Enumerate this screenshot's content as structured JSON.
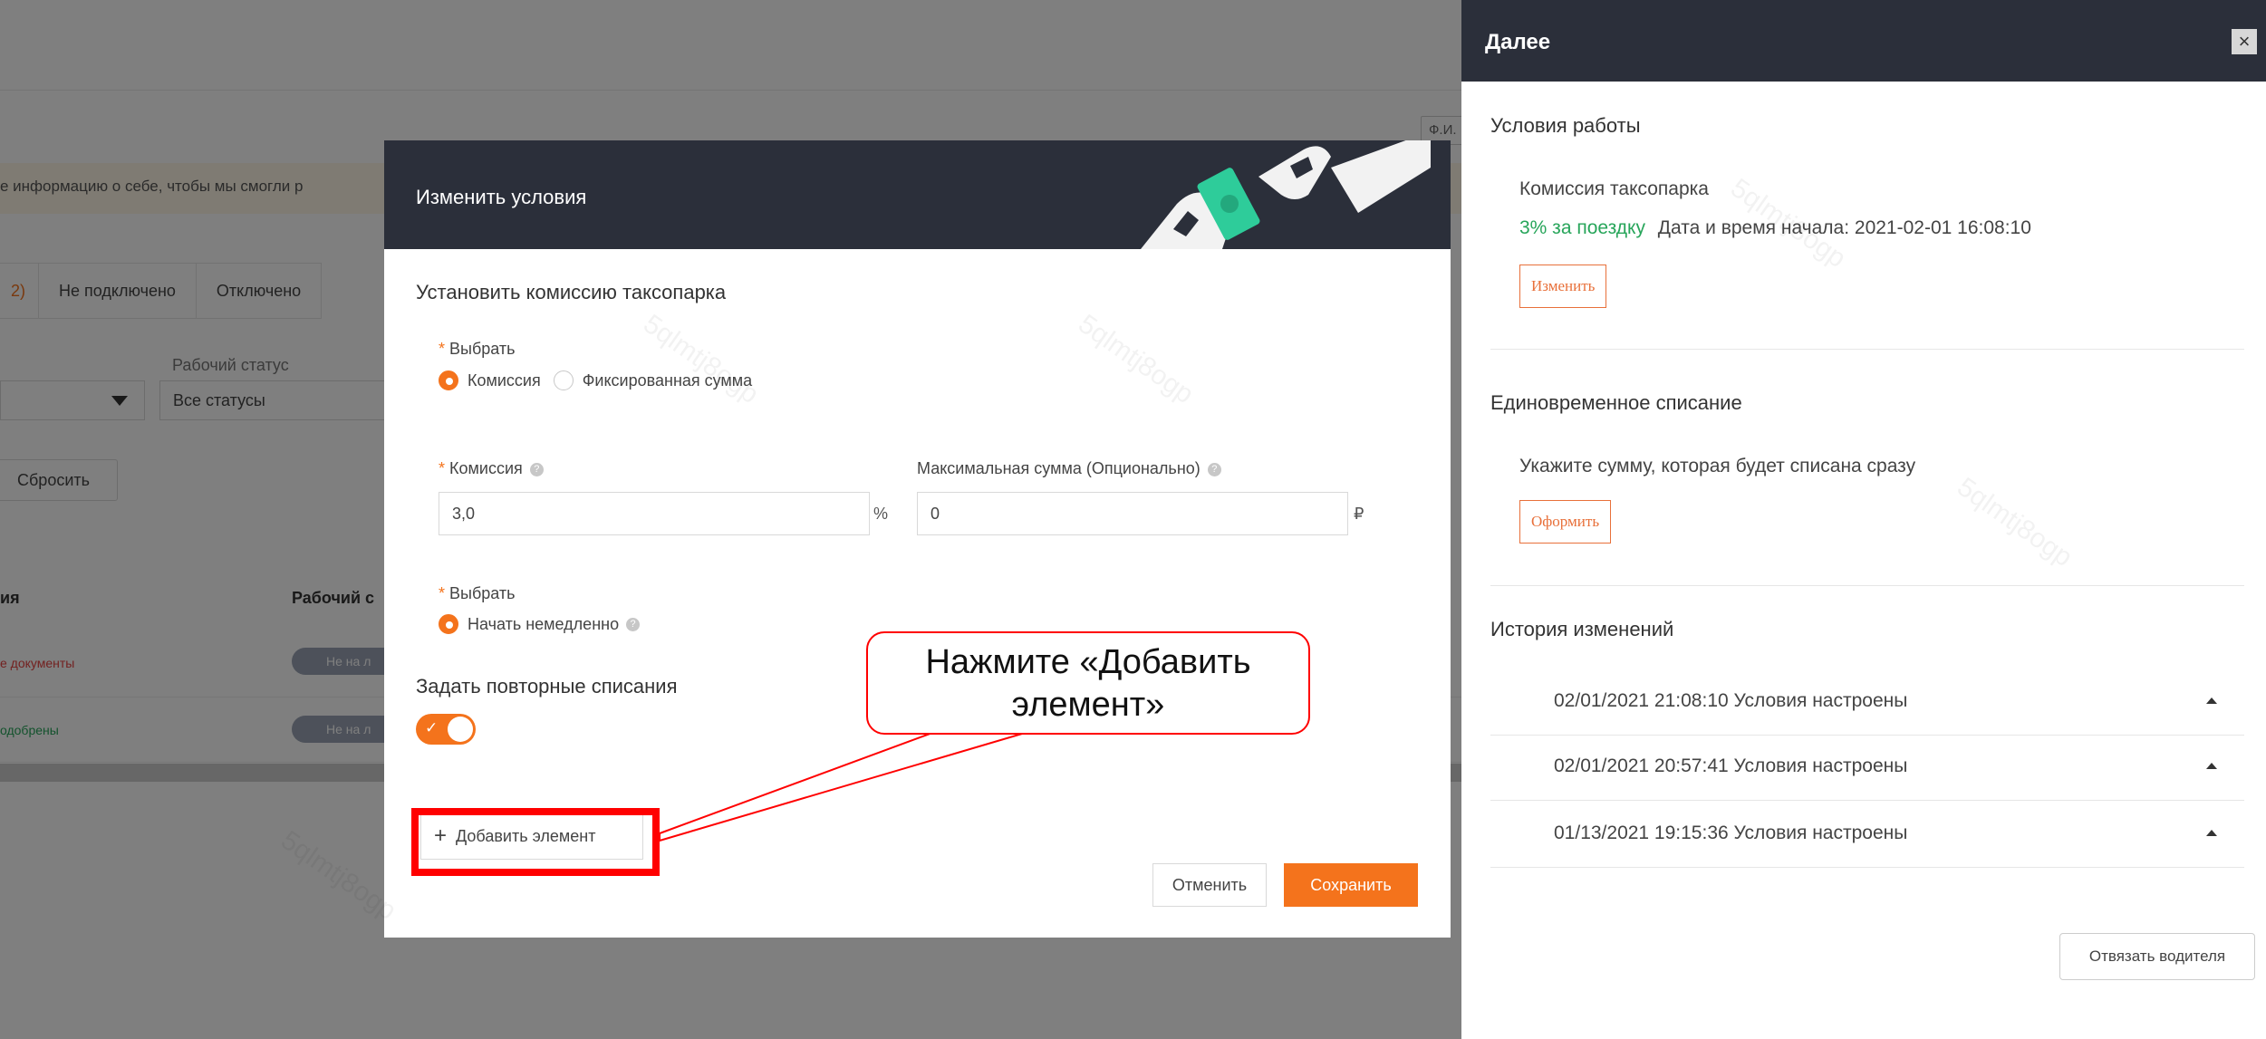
{
  "background": {
    "fio_label": "Ф.И.",
    "notice_text": "е информацию о себе, чтобы мы смогли р",
    "tabs": [
      {
        "label": "2)"
      },
      {
        "label": "Не подключено"
      },
      {
        "label": "Отключено"
      }
    ],
    "work_status_label": "Рабочий статус",
    "work_status_value": "Все статусы",
    "reset_button": "Сбросить",
    "table": {
      "col1": "ия",
      "col2": "Рабочий с",
      "rows": [
        {
          "status": "е документы",
          "pill": "Не на л"
        },
        {
          "status": "одобрены",
          "pill": "Не на л"
        }
      ]
    }
  },
  "modal": {
    "title": "Изменить условия",
    "section_commission": "Установить комиссию таксопарка",
    "select_label_1": "Выбрать",
    "radio_commission": "Комиссия",
    "radio_fixed": "Фиксированная сумма",
    "commission_label": "Комиссия",
    "commission_value": "3,0",
    "commission_suffix": "%",
    "max_sum_label": "Максимальная сумма (Опционально)",
    "max_sum_value": "0",
    "max_sum_suffix": "₽",
    "select_label_2": "Выбрать",
    "radio_start_now": "Начать немедленно",
    "recurring_title": "Задать повторные списания",
    "add_item_button": "Добавить элемент",
    "cancel_button": "Отменить",
    "save_button": "Сохранить"
  },
  "callout": {
    "line1": "Нажмите «Добавить",
    "line2": "элемент»"
  },
  "drawer": {
    "title": "Далее",
    "section_conditions": "Условия работы",
    "fleet_commission_label": "Комиссия таксопарка",
    "commission_rate": "3% за поездку",
    "start_datetime": "Дата и время начала: 2021-02-01 16:08:10",
    "change_button": "Изменить",
    "section_one_time": "Единовременное списание",
    "one_time_hint": "Укажите сумму, которая будет списана сразу",
    "issue_button": "Оформить",
    "section_history": "История изменений",
    "history": [
      {
        "text": "02/01/2021 21:08:10 Условия настроены"
      },
      {
        "text": "02/01/2021 20:57:41 Условия настроены"
      },
      {
        "text": "01/13/2021 19:15:36 Условия настроены"
      }
    ],
    "unbind_button": "Отвязать водителя"
  },
  "watermark_text": "5qlmtj8ogp",
  "colors": {
    "accent": "#f4731c",
    "header_dark": "#2b2f3a",
    "green": "#27a55a",
    "callout_red": "#ff0000"
  }
}
